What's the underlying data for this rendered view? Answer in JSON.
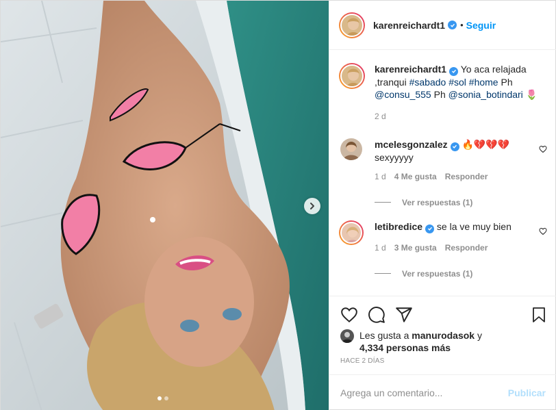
{
  "post": {
    "photo_alt_icon": "photo",
    "carousel": {
      "count": 2,
      "active": 1
    }
  },
  "header": {
    "username": "karenreichardt1",
    "separator": "•",
    "follow_label": "Seguir"
  },
  "caption": {
    "username": "karenreichardt1",
    "text_before": "Yo aca relajada ,tranqui ",
    "hashtags": [
      "#sabado",
      "#sol",
      "#home"
    ],
    "text_ph1": "Ph",
    "mention1": "@consu_555",
    "text_ph2": "Ph",
    "mention2": "@sonia_botindari",
    "emoji": "🌷",
    "time": "2 d"
  },
  "comments": [
    {
      "username": "mcelesgonzalez",
      "emoji": "🔥💔💔💔",
      "text": "sexyyyyy",
      "time": "1 d",
      "likes": "4 Me gusta",
      "reply_label": "Responder",
      "view_replies": "Ver respuestas (1)"
    },
    {
      "username": "letibredice",
      "text": "se la ve muy bien",
      "time": "1 d",
      "likes": "3 Me gusta",
      "reply_label": "Responder",
      "view_replies": "Ver respuestas (1)"
    }
  ],
  "likes": {
    "prefix": "Les gusta a",
    "user": "manurodasok",
    "suffix": "y",
    "count": "4,334 personas más"
  },
  "time_ago": "HACE 2 DÍAS",
  "add_comment": {
    "placeholder": "Agrega un comentario...",
    "publish_label": "Publicar"
  },
  "colors": {
    "accent": "#0095f6",
    "publish_disabled": "#b2dffc",
    "verified": "#3897f0",
    "link": "#00376b",
    "muted": "#8e8e8e"
  }
}
